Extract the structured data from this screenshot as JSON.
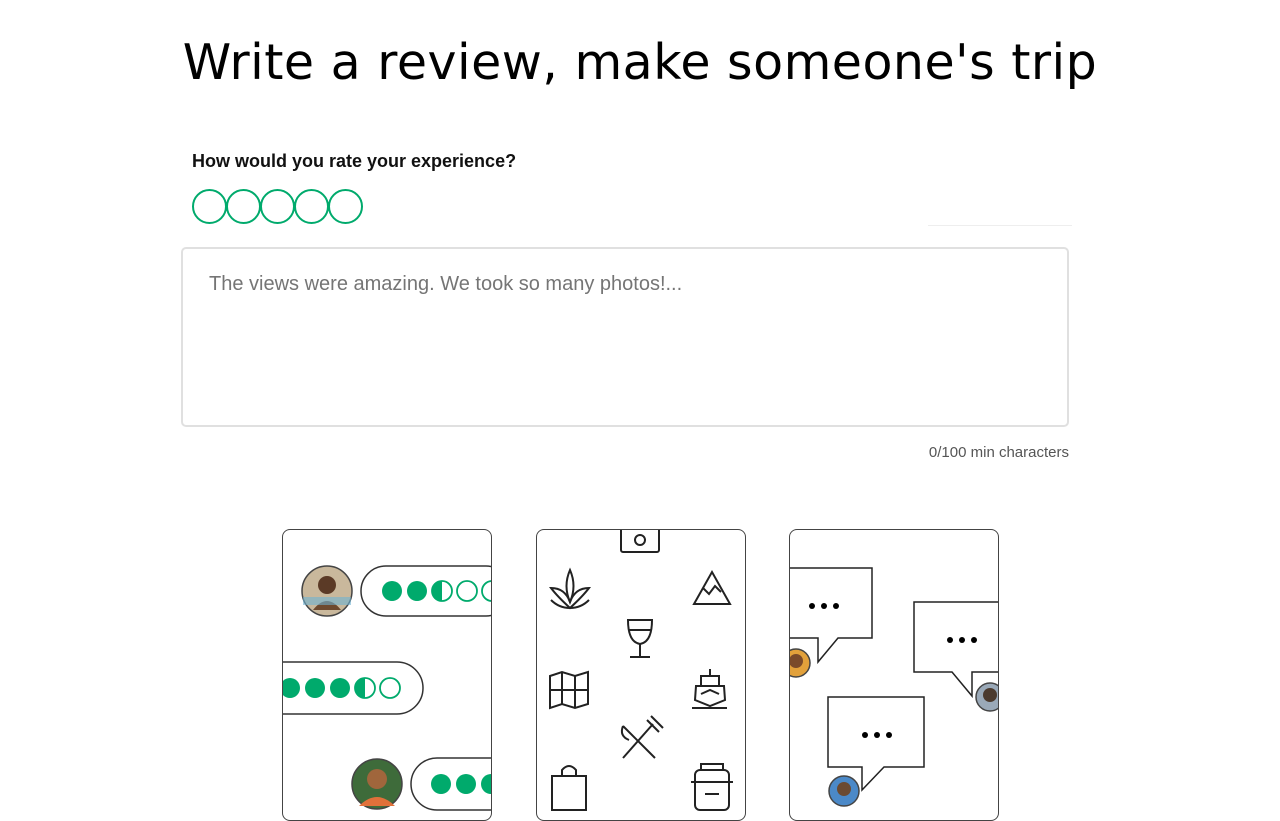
{
  "page": {
    "title": "Write a review, make someone's trip"
  },
  "rating": {
    "label": "How would you rate your experience?",
    "max": 5,
    "value": 0,
    "accent_color": "#00aa6c"
  },
  "review": {
    "placeholder": "The views were amazing. We took so many photos!...",
    "value": "",
    "char_count": "0/100 min characters"
  },
  "illustrations": {
    "cards": [
      {
        "name": "rating-bubbles-card",
        "icons": [
          "avatar",
          "rating-bubbles"
        ]
      },
      {
        "name": "travel-icons-card",
        "icons": [
          "camera-icon",
          "lotus-icon",
          "mountain-icon",
          "wine-glass-icon",
          "map-icon",
          "ship-icon",
          "fork-knife-icon",
          "shopping-bag-icon",
          "luggage-icon"
        ]
      },
      {
        "name": "chat-bubbles-card",
        "icons": [
          "chat-bubble-icon",
          "avatar"
        ]
      }
    ]
  }
}
